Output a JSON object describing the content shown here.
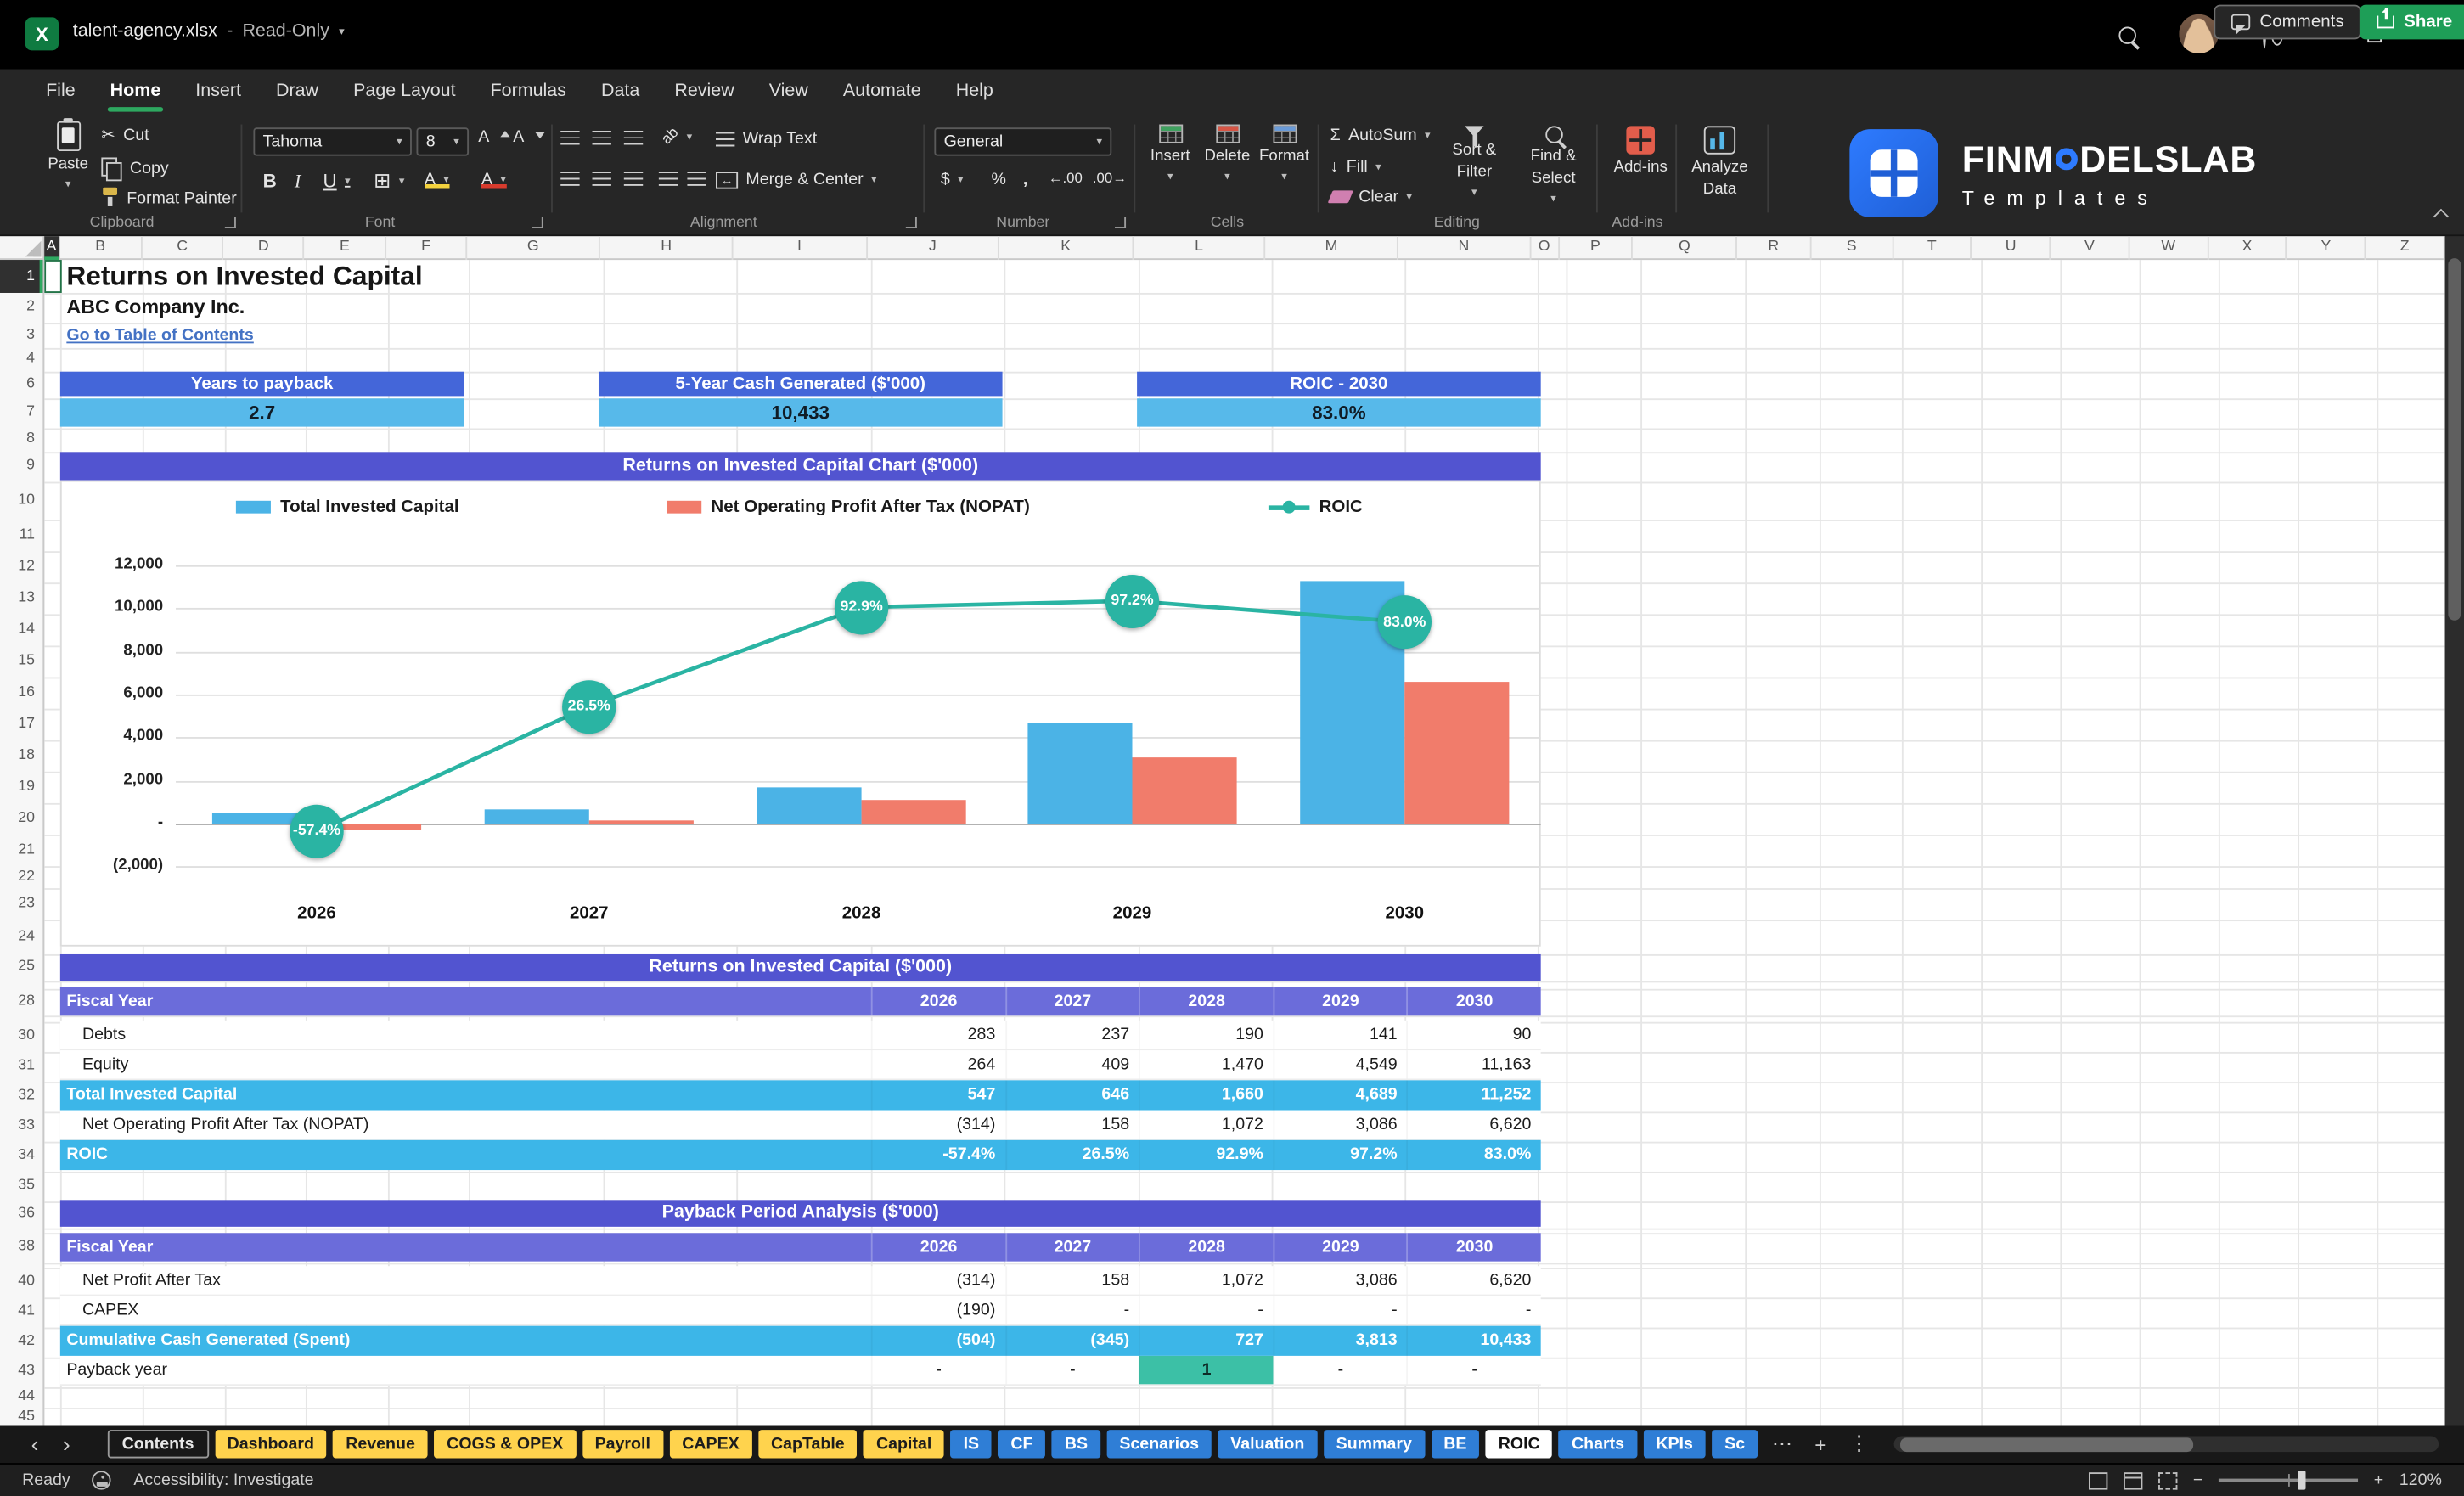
{
  "icons": {
    "excel_letter": "X",
    "dropdown": "▾",
    "scissors": "✂",
    "bold": "B",
    "italic": "I",
    "underline": "U",
    "borders": "⊞",
    "font_letter": "A",
    "sigma": "Σ",
    "dollar": "$",
    "percent": "%",
    "comma": ",",
    "inc_decimal": "←.00",
    "dec_decimal": ".00→",
    "orientation_ab": "ab",
    "merge_arrows": "↔",
    "fill_arrow": "↓",
    "chevron_left": "‹",
    "chevron_right": "›",
    "more": "⋯",
    "plus": "+",
    "kebab": "⋮",
    "minimize": "–",
    "close": "×",
    "minus": "−",
    "zoom_plus": "+"
  },
  "titlebar": {
    "filename": "talent-agency.xlsx",
    "separator": "-",
    "mode": "Read-Only"
  },
  "menubar": {
    "items": [
      {
        "label": "File"
      },
      {
        "label": "Home",
        "active": true
      },
      {
        "label": "Insert"
      },
      {
        "label": "Draw"
      },
      {
        "label": "Page Layout"
      },
      {
        "label": "Formulas"
      },
      {
        "label": "Data"
      },
      {
        "label": "Review"
      },
      {
        "label": "View"
      },
      {
        "label": "Automate"
      },
      {
        "label": "Help"
      }
    ],
    "comments": "Comments",
    "share": "Share"
  },
  "ribbon": {
    "clipboard": {
      "group": "Clipboard",
      "paste": "Paste",
      "cut": "Cut",
      "copy": "Copy",
      "painter": "Format Painter"
    },
    "font": {
      "group": "Font",
      "name": "Tahoma",
      "size": "8"
    },
    "alignment": {
      "group": "Alignment",
      "wrap": "Wrap Text",
      "merge": "Merge & Center"
    },
    "number": {
      "group": "Number",
      "format": "General"
    },
    "cells": {
      "group": "Cells",
      "insert": "Insert",
      "del": "Delete",
      "format": "Format"
    },
    "editing": {
      "group": "Editing",
      "autosum": "AutoSum",
      "fill": "Fill",
      "clear": "Clear",
      "sort1": "Sort &",
      "sort2": "Filter",
      "find1": "Find &",
      "find2": "Select"
    },
    "addins": {
      "group": "Add-ins",
      "label": "Add-ins",
      "analyze1": "Analyze",
      "analyze2": "Data"
    }
  },
  "brand": {
    "pre": "FINM",
    "post": "DELSLAB",
    "tagline": "Templates"
  },
  "sheet": {
    "columns": [
      "A",
      "B",
      "C",
      "D",
      "E",
      "F",
      "G",
      "H",
      "I",
      "J",
      "K",
      "L",
      "M",
      "N",
      "O",
      "P",
      "Q",
      "R",
      "S",
      "T",
      "U",
      "V",
      "W",
      "X",
      "Y",
      "Z"
    ],
    "rows": [
      "1",
      "2",
      "3",
      "4",
      "6",
      "7",
      "8",
      "9",
      "10",
      "11",
      "12",
      "13",
      "14",
      "15",
      "16",
      "17",
      "18",
      "19",
      "20",
      "21",
      "22",
      "23",
      "24",
      "25",
      "28",
      "30",
      "31",
      "32",
      "33",
      "34",
      "35",
      "36",
      "38",
      "40",
      "41",
      "42",
      "43",
      "44",
      "45"
    ],
    "title": "Returns on Invested Capital",
    "company": "ABC Company Inc.",
    "toc_link": "Go to Table of Contents",
    "kpis": [
      {
        "label": "Years to payback",
        "value": "2.7"
      },
      {
        "label": "5-Year Cash Generated ($'000)",
        "value": "10,433"
      },
      {
        "label": "ROIC - 2030",
        "value": "83.0%"
      }
    ]
  },
  "chart_data": {
    "type": "combo",
    "title": "Returns on Invested Capital Chart ($'000)",
    "categories": [
      "2026",
      "2027",
      "2028",
      "2029",
      "2030"
    ],
    "series": [
      {
        "name": "Total Invested Capital",
        "chart": "bar",
        "color": "#4bb3e6",
        "values": [
          547,
          646,
          1660,
          4689,
          11252
        ]
      },
      {
        "name": "Net Operating Profit After Tax (NOPAT)",
        "chart": "bar",
        "color": "#f17c6b",
        "values": [
          -314,
          158,
          1072,
          3086,
          6620
        ]
      },
      {
        "name": "ROIC",
        "chart": "line",
        "color": "#2ab4a3",
        "values": [
          -57.4,
          26.5,
          92.9,
          97.2,
          83.0
        ],
        "labels": [
          "-57.4%",
          "26.5%",
          "92.9%",
          "97.2%",
          "83.0%"
        ]
      }
    ],
    "y_axis": {
      "min": -2000,
      "max": 12000,
      "step": 2000,
      "ticks": [
        "12,000",
        "10,000",
        "8,000",
        "6,000",
        "4,000",
        "2,000",
        "-",
        "(2,000)"
      ]
    },
    "legend_position": "top",
    "grid": true
  },
  "tables": [
    {
      "title": "Returns on Invested Capital ($'000)",
      "header_label": "Fiscal Year",
      "years": [
        "2026",
        "2027",
        "2028",
        "2029",
        "2030"
      ],
      "rows": [
        {
          "label": "Debts",
          "style": "plain",
          "values": [
            "283",
            "237",
            "190",
            "141",
            "90"
          ]
        },
        {
          "label": "Equity",
          "style": "plain",
          "values": [
            "264",
            "409",
            "1,470",
            "4,549",
            "11,163"
          ]
        },
        {
          "label": "Total Invested Capital",
          "style": "total",
          "values": [
            "547",
            "646",
            "1,660",
            "4,689",
            "11,252"
          ]
        },
        {
          "label": "Net Operating Profit After Tax (NOPAT)",
          "style": "plain",
          "values": [
            "(314)",
            "158",
            "1,072",
            "3,086",
            "6,620"
          ]
        },
        {
          "label": "ROIC",
          "style": "total",
          "values": [
            "-57.4%",
            "26.5%",
            "92.9%",
            "97.2%",
            "83.0%"
          ]
        }
      ]
    },
    {
      "title": "Payback Period Analysis ($'000)",
      "header_label": "Fiscal Year",
      "years": [
        "2026",
        "2027",
        "2028",
        "2029",
        "2030"
      ],
      "rows": [
        {
          "label": "Net Profit After Tax",
          "style": "plain",
          "values": [
            "(314)",
            "158",
            "1,072",
            "3,086",
            "6,620"
          ]
        },
        {
          "label": "CAPEX",
          "style": "plain",
          "values": [
            "(190)",
            "-",
            "-",
            "-",
            "-"
          ]
        },
        {
          "label": "Cumulative Cash Generated (Spent)",
          "style": "total",
          "values": [
            "(504)",
            "(345)",
            "727",
            "3,813",
            "10,433"
          ]
        },
        {
          "label": "Payback year",
          "style": "payback",
          "values": [
            "-",
            "-",
            "1",
            "-",
            "-"
          ]
        }
      ]
    }
  ],
  "tabs": {
    "items": [
      {
        "label": "Contents",
        "color": "ghost"
      },
      {
        "label": "Dashboard",
        "color": "yellow"
      },
      {
        "label": "Revenue",
        "color": "yellow"
      },
      {
        "label": "COGS & OPEX",
        "color": "yellow"
      },
      {
        "label": "Payroll",
        "color": "yellow"
      },
      {
        "label": "CAPEX",
        "color": "yellow"
      },
      {
        "label": "CapTable",
        "color": "yellow"
      },
      {
        "label": "Capital",
        "color": "yellow"
      },
      {
        "label": "IS",
        "color": "blue"
      },
      {
        "label": "CF",
        "color": "blue"
      },
      {
        "label": "BS",
        "color": "blue"
      },
      {
        "label": "Scenarios",
        "color": "blue"
      },
      {
        "label": "Valuation",
        "color": "blue"
      },
      {
        "label": "Summary",
        "color": "blue"
      },
      {
        "label": "BE",
        "color": "blue"
      },
      {
        "label": "ROIC",
        "color": "active"
      },
      {
        "label": "Charts",
        "color": "blue"
      },
      {
        "label": "KPIs",
        "color": "blue"
      },
      {
        "label": "Sc",
        "color": "blue"
      }
    ]
  },
  "statusbar": {
    "ready": "Ready",
    "accessibility": "Accessibility: Investigate",
    "zoom": "120%"
  }
}
